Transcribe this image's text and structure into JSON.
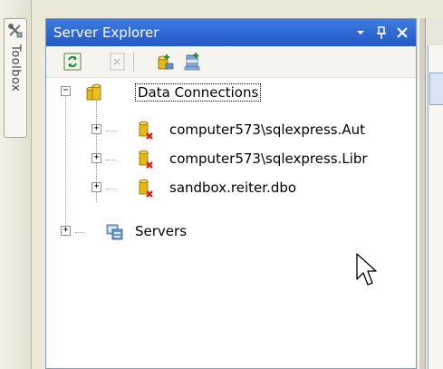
{
  "toolbox": {
    "label": "Toolbox",
    "icon": "toolbox-icon"
  },
  "panel": {
    "title": "Server Explorer",
    "buttons": {
      "dropdown": "▾",
      "pin": "\u0004",
      "close": "✕"
    },
    "toolbar": [
      {
        "name": "refresh-icon"
      },
      {
        "name": "stop-icon"
      },
      {
        "name": "connect-to-database-icon"
      },
      {
        "name": "connect-to-server-icon"
      }
    ]
  },
  "tree": {
    "data_connections": {
      "label": "Data Connections",
      "children": [
        {
          "label": "computer573\\sqlexpress.Aut"
        },
        {
          "label": "computer573\\sqlexpress.Libr"
        },
        {
          "label": "sandbox.reiter.dbo"
        }
      ]
    },
    "servers": {
      "label": "Servers"
    }
  },
  "colors": {
    "title_bar": "#2B63CE",
    "selection_border": "#000000",
    "db_icon": "#E9B400",
    "error_x": "#D41E16"
  }
}
